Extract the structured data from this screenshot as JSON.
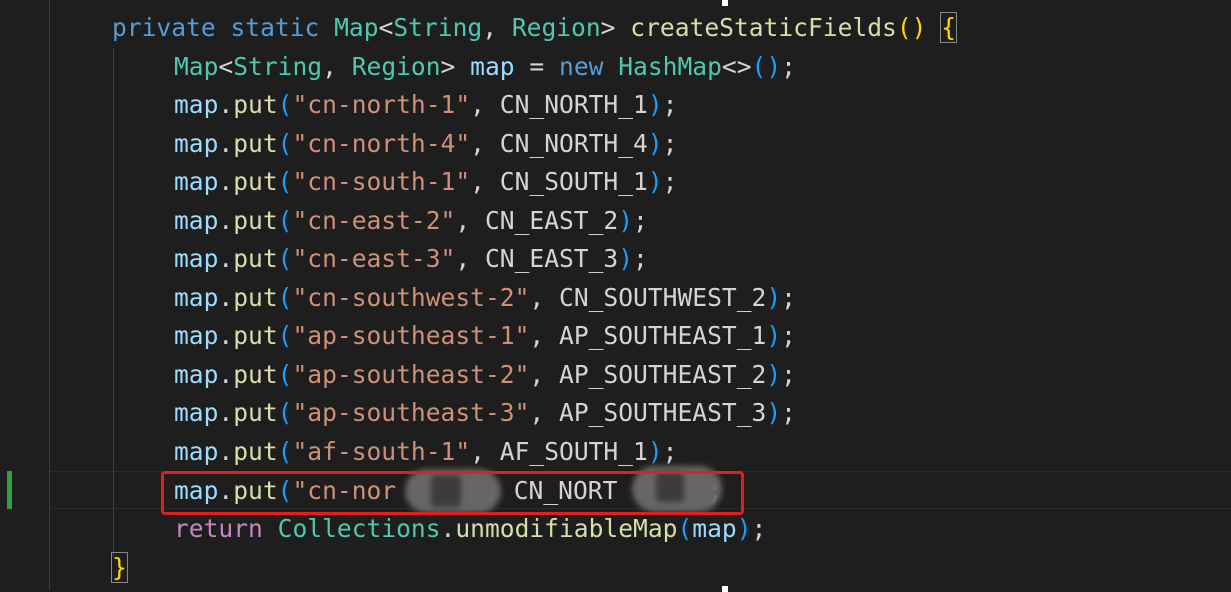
{
  "code": {
    "line1": {
      "kw1": "private",
      "kw2": "static",
      "type1": "Map",
      "lt": "<",
      "type2": "String",
      "comma": ", ",
      "type3": "Region",
      "gt": ">",
      "fn": "createStaticFields",
      "paren_open": "(",
      "paren_close": ")",
      "brace": "{"
    },
    "line2": {
      "type1": "Map",
      "lt": "<",
      "type2": "String",
      "comma": ", ",
      "type3": "Region",
      "gt": ">",
      "var": "map",
      "eq": " = ",
      "kw": "new",
      "type4": "HashMap",
      "diamond": "<>",
      "paren_open": "(",
      "paren_close": ")",
      "semi": ";"
    },
    "put_lines": [
      {
        "key": "\"cn-north-1\"",
        "const": "CN_NORTH_1"
      },
      {
        "key": "\"cn-north-4\"",
        "const": "CN_NORTH_4"
      },
      {
        "key": "\"cn-south-1\"",
        "const": "CN_SOUTH_1"
      },
      {
        "key": "\"cn-east-2\"",
        "const": "CN_EAST_2"
      },
      {
        "key": "\"cn-east-3\"",
        "const": "CN_EAST_3"
      },
      {
        "key": "\"cn-southwest-2\"",
        "const": "CN_SOUTHWEST_2"
      },
      {
        "key": "\"ap-southeast-1\"",
        "const": "AP_SOUTHEAST_1"
      },
      {
        "key": "\"ap-southeast-2\"",
        "const": "AP_SOUTHEAST_2"
      },
      {
        "key": "\"ap-southeast-3\"",
        "const": "AP_SOUTHEAST_3"
      },
      {
        "key": "\"af-south-1\"",
        "const": "AF_SOUTH_1"
      }
    ],
    "put_tokens": {
      "obj": "map",
      "dot": ".",
      "method": "put",
      "paren_open": "(",
      "comma": ", ",
      "paren_close": ")",
      "semi": ";"
    },
    "redacted_line": {
      "key_visible": "\"cn-nor",
      "comma": ", ",
      "const_visible": "CN_NORT",
      "semi": ";"
    },
    "return_line": {
      "kw": "return",
      "type": "Collections",
      "dot": ".",
      "fn": "unmodifiableMap",
      "paren_open": "(",
      "arg": "map",
      "paren_close": ")",
      "semi": ";"
    },
    "closing_brace": "}"
  },
  "colors": {
    "background": "#1e1e1e",
    "keyword": "#569cd6",
    "control_keyword": "#c586c0",
    "type": "#4ec9b0",
    "function": "#dcdcaa",
    "variable": "#9cdcfe",
    "string": "#ce9178",
    "highlight_box": "#e02020",
    "git_modified": "#2ea043"
  }
}
